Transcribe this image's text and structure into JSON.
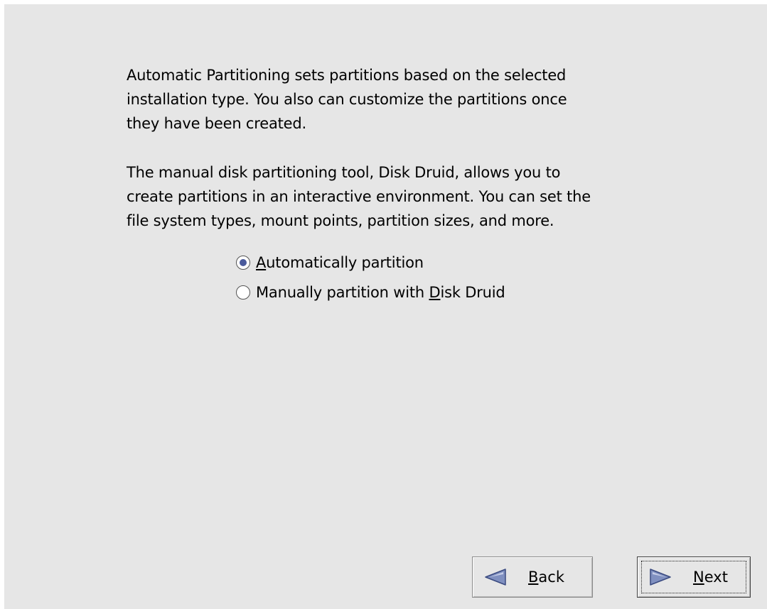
{
  "intro": {
    "auto_lines": [
      "Automatic Partitioning sets partitions based on the selected",
      "installation type. You also can customize the partitions once",
      "they have been created."
    ],
    "manual_lines": [
      "The manual disk partitioning tool, Disk Druid, allows you to",
      "create partitions in an interactive environment. You can set the",
      "file system types, mount points, partition sizes, and more."
    ]
  },
  "options": [
    {
      "label_mnemonic": "A",
      "label_rest": "utomatically partition",
      "selected": true
    },
    {
      "label_before": "Manually partition with ",
      "label_mnemonic": "D",
      "label_after": "isk Druid",
      "selected": false
    }
  ],
  "buttons": {
    "back": {
      "mnemonic": "B",
      "rest": "ack",
      "icon": "left-arrow-icon"
    },
    "next": {
      "mnemonic": "N",
      "rest": "ext",
      "icon": "right-arrow-icon"
    }
  },
  "colors": {
    "background": "#e6e6e6",
    "radio_selected": "#4a5a9c",
    "arrow_fill": "#8090c0"
  }
}
